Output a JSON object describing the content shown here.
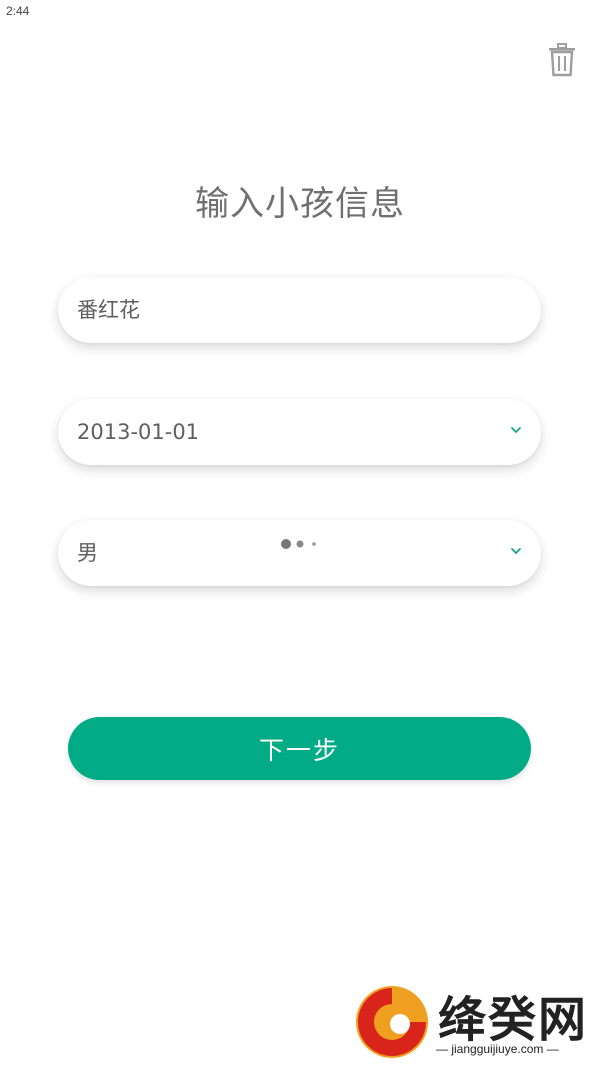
{
  "status_bar": {
    "time": "2:44"
  },
  "header": {
    "title": "输入小孩信息",
    "delete_icon": "trash-icon"
  },
  "form": {
    "name_value": "番红花",
    "birthdate_value": "2013-01-01",
    "gender_value": "男",
    "dropdown_icon": "chevron-down-icon"
  },
  "actions": {
    "next_label": "下一步"
  },
  "watermark": {
    "text": "绛癸网",
    "url": "jiangguijiuye.com"
  },
  "colors": {
    "accent": "#00ab86",
    "chevron": "#1aa58a",
    "title": "#707070",
    "icon": "#9e9e9e"
  }
}
